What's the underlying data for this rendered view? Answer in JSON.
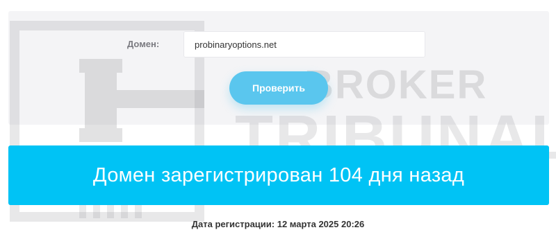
{
  "form": {
    "domain_label": "Домен:",
    "domain_value": "probinaryoptions.net",
    "check_button_label": "Проверить"
  },
  "result": {
    "message": "Домен зарегистрирован 104 дня назад",
    "registration_date_text": "Дата регистрации: 12 марта 2025 20:26"
  },
  "watermark": {
    "line1": "BROKER",
    "line2": "TRIBUNAL",
    "logo_icon": "gavel-icon"
  },
  "colors": {
    "banner": "#00c3f5",
    "button": "#5ac6ee",
    "panel": "#f4f4f6"
  }
}
